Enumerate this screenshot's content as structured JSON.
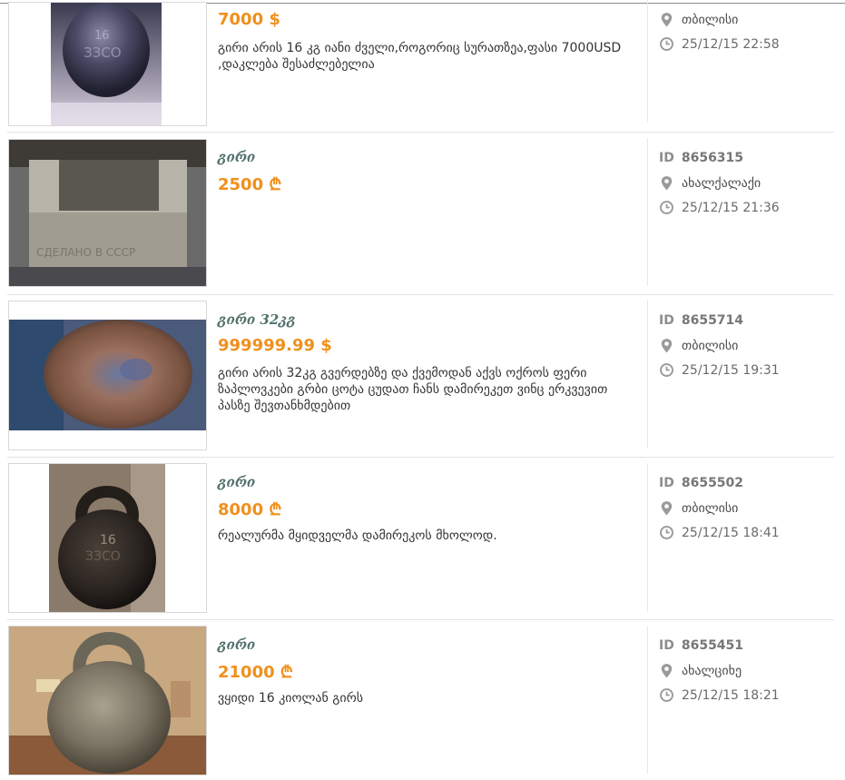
{
  "listings": [
    {
      "title": "",
      "price": "7000 $",
      "description": "გირი არის 16 კგ იანი ძველი,როგორიც სურათზეა,ფასი 7000USD ,დაკლება შესაძლებელია",
      "id_label": "",
      "id": "",
      "location": "თბილისი",
      "datetime": "25/12/15 22:58",
      "photo_icon": "kettlebell-photo"
    },
    {
      "title": "გირი",
      "price": "2500 ₾",
      "description": "",
      "id_label": "ID",
      "id": "8656315",
      "location": "ახალქალაქი",
      "datetime": "25/12/15 21:36",
      "photo_icon": "weight-block-photo",
      "photo_text": "СДЕЛАНО В СССР"
    },
    {
      "title": "გირი 32კგ",
      "price": "999999.99 $",
      "description": "გირი არის 32კგ გვერდებზე და ქვემოდან აქვს ოქროს ფერი ზაპლოვკები გრბი ცოტა ცუდათ ჩანს დამირეკეთ ვინც ერკვევით პასზე შევთანხმდებით",
      "id_label": "ID",
      "id": "8655714",
      "location": "თბილისი",
      "datetime": "25/12/15 19:31",
      "photo_icon": "rusty-weight-photo"
    },
    {
      "title": "გირი",
      "price": "8000 ₾",
      "description": "რეალურმა მყიდველმა დამირეკოს მხოლოდ.",
      "id_label": "ID",
      "id": "8655502",
      "location": "თბილისი",
      "datetime": "25/12/15 18:41",
      "photo_icon": "kettlebell-photo",
      "photo_text": "16"
    },
    {
      "title": "გირი",
      "price": "21000 ₾",
      "description": "ვყიდი 16 კიოლან გირს",
      "id_label": "ID",
      "id": "8655451",
      "location": "ახალციხე",
      "datetime": "25/12/15 18:21",
      "photo_icon": "kettlebell-photo"
    }
  ],
  "icons": {
    "location": "map-pin-icon",
    "time": "clock-icon"
  },
  "colors": {
    "price": "#f0901c",
    "title": "#51706a",
    "meta_icon": "#9a9a9a"
  }
}
